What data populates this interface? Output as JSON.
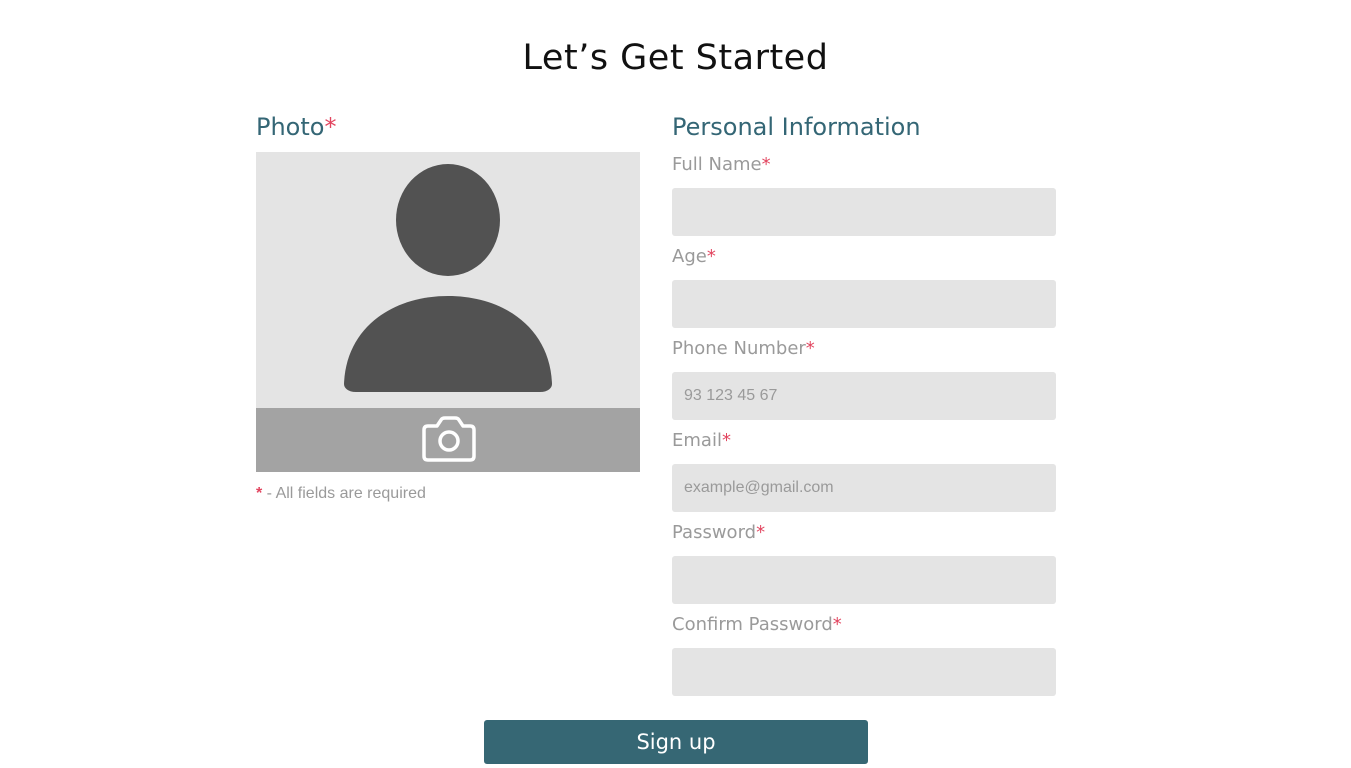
{
  "page": {
    "title": "Let’s Get Started"
  },
  "photo": {
    "heading": "Photo",
    "required_mark": "*",
    "avatar_icon": "user-silhouette-icon",
    "camera_icon": "camera-icon"
  },
  "required_note": {
    "mark": "*",
    "text": " - All fields are required"
  },
  "personal_info": {
    "heading": "Personal Information",
    "fields": [
      {
        "label": "Full Name",
        "required_mark": "*",
        "value": "",
        "placeholder": ""
      },
      {
        "label": "Age",
        "required_mark": "*",
        "value": "",
        "placeholder": ""
      },
      {
        "label": "Phone Number",
        "required_mark": "*",
        "value": "",
        "placeholder": "93 123 45 67"
      },
      {
        "label": "Email",
        "required_mark": "*",
        "value": "",
        "placeholder": "example@gmail.com"
      },
      {
        "label": "Password",
        "required_mark": "*",
        "value": "",
        "placeholder": ""
      },
      {
        "label": "Confirm Password",
        "required_mark": "*",
        "value": "",
        "placeholder": ""
      }
    ]
  },
  "signup": {
    "label": "Sign up"
  },
  "colors": {
    "accent": "#366774",
    "heading": "#346675",
    "required": "#e2455f",
    "input_bg": "#e4e4e4",
    "label": "#9a9a9a"
  }
}
